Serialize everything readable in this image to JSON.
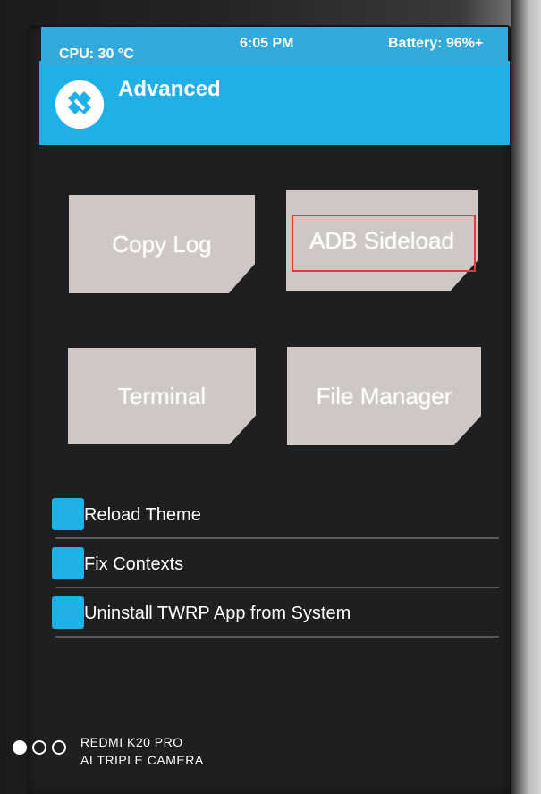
{
  "status_bar": {
    "cpu": "CPU: 30 °C",
    "time": "6:05 PM",
    "battery": "Battery: 96%+"
  },
  "header": {
    "title": "Advanced",
    "logo_icon": "twrp-logo-icon"
  },
  "buttons": {
    "copy_log": "Copy Log",
    "adb_sideload": "ADB Sideload",
    "terminal": "Terminal",
    "file_manager": "File Manager"
  },
  "checkboxes": [
    {
      "label": "Reload Theme"
    },
    {
      "label": "Fix Contexts"
    },
    {
      "label": "Uninstall TWRP App from System"
    }
  ],
  "watermark": {
    "line1": "REDMI K20 PRO",
    "line2": "AI TRIPLE CAMERA"
  },
  "colors": {
    "accent": "#20b0e8",
    "button_bg": "#cfc7c3",
    "screen_bg": "#1f1f21",
    "highlight": "#e53935"
  }
}
